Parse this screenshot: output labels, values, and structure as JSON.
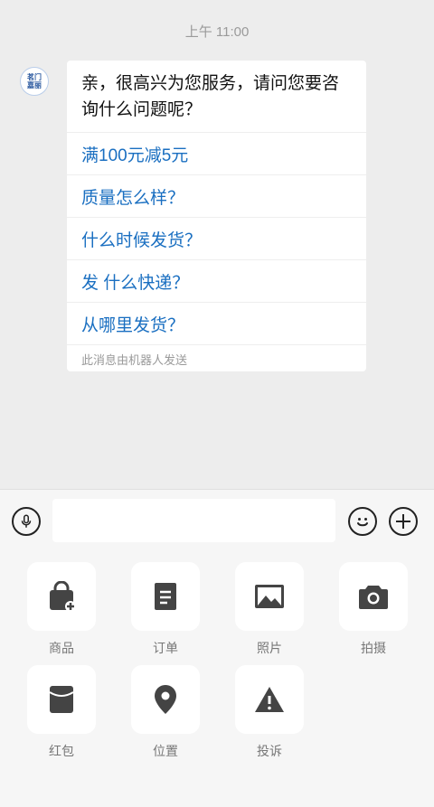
{
  "chat": {
    "timestamp": "上午 11:00",
    "avatar": {
      "name": "茗门嘉丽",
      "icon": "brand-logo"
    },
    "message": {
      "greeting": "亲，很高兴为您服务，请问您要咨询什么问题呢？",
      "options": [
        "满100元减5元",
        "质量怎么样？",
        "什么时候发货？",
        "发 什么快递？",
        "从哪里发货？"
      ],
      "footer": "此消息由机器人发送"
    }
  },
  "input_bar": {
    "voice_icon": "microphone-icon",
    "placeholder": "",
    "emoji_icon": "smiley-icon",
    "more_icon": "plus-icon"
  },
  "panel": {
    "items": [
      {
        "label": "商品",
        "icon": "shopping-bag-add-icon"
      },
      {
        "label": "订单",
        "icon": "document-icon"
      },
      {
        "label": "照片",
        "icon": "image-icon"
      },
      {
        "label": "拍摄",
        "icon": "camera-icon"
      },
      {
        "label": "红包",
        "icon": "red-envelope-icon"
      },
      {
        "label": "位置",
        "icon": "location-pin-icon"
      },
      {
        "label": "投诉",
        "icon": "warning-icon"
      }
    ]
  },
  "colors": {
    "link": "#1a6fc1",
    "background": "#ededed",
    "icon": "#444444"
  }
}
